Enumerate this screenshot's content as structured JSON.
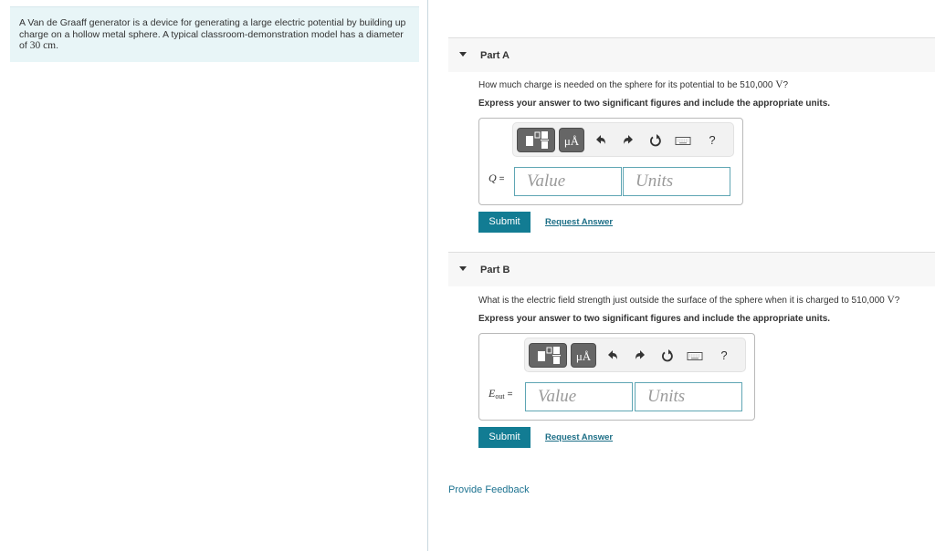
{
  "intro": {
    "text_before_math": "A Van de Graaff generator is a device for generating a large electric potential by building up charge on a hollow metal sphere. A typical classroom-demonstration model has a diameter of ",
    "math": "30 cm",
    "text_after_math": "."
  },
  "parts": [
    {
      "title": "Part A",
      "question_before_math": "How much charge is needed on the sphere for its potential to be 510,000 ",
      "question_math": "V",
      "question_after_math": "?",
      "instruction": "Express your answer to two significant figures and include the appropriate units.",
      "variable": "Q",
      "variable_sub": "",
      "equals": "=",
      "value_placeholder": "Value",
      "units_placeholder": "Units",
      "submit_label": "Submit",
      "request_answer_label": "Request Answer"
    },
    {
      "title": "Part B",
      "question_before_math": "What is the electric field strength just outside the surface of the sphere when it is charged to 510,000 ",
      "question_math": "V",
      "question_after_math": "?",
      "instruction": "Express your answer to two significant figures and include the appropriate units.",
      "variable": "E",
      "variable_sub": "out",
      "equals": "=",
      "value_placeholder": "Value",
      "units_placeholder": "Units",
      "submit_label": "Submit",
      "request_answer_label": "Request Answer"
    }
  ],
  "toolbar": {
    "templates_icon": "templates-icon",
    "units_icon_label": "μÅ",
    "undo_icon": "undo-icon",
    "redo_icon": "redo-icon",
    "reset_icon": "reset-icon",
    "keyboard_icon": "keyboard-icon",
    "help_label": "?"
  },
  "feedback_label": "Provide Feedback",
  "colors": {
    "submit_bg": "#127c93",
    "link": "#1c6e86",
    "intro_bg": "#e8f5f7",
    "field_border": "#5fa6b4"
  }
}
